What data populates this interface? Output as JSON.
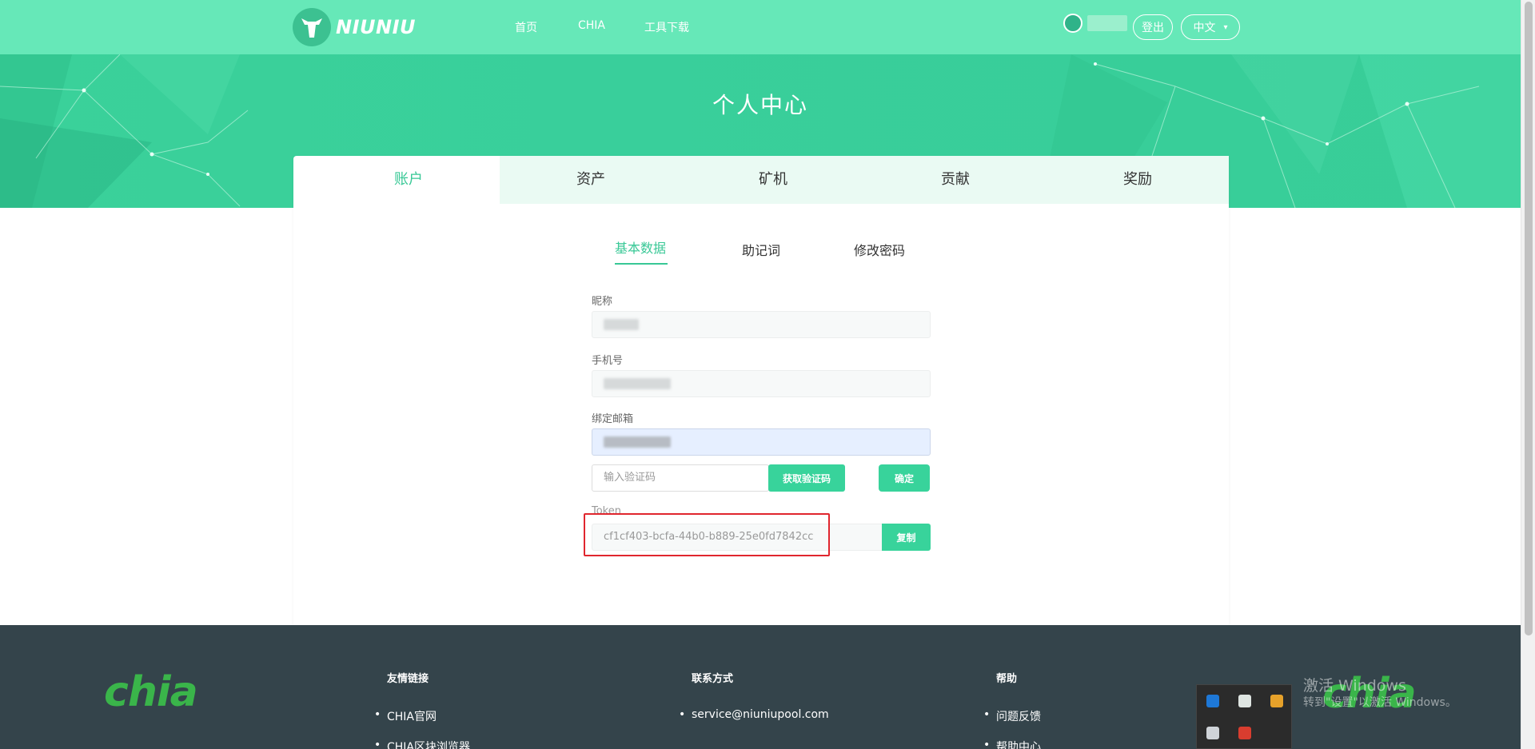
{
  "header": {
    "logo_text": "NIUNIU",
    "nav": [
      "首页",
      "CHIA",
      "工具下载"
    ],
    "logout_label": "登出",
    "language_label": "中文",
    "language_caret": "▾"
  },
  "hero": {
    "title": "个人中心"
  },
  "tabs": [
    "账户",
    "资产",
    "矿机",
    "贡献",
    "奖励"
  ],
  "subtabs": [
    "基本数据",
    "助记词",
    "修改密码"
  ],
  "form": {
    "nickname_label": "昵称",
    "phone_label": "手机号",
    "email_label": "绑定邮箱",
    "code_placeholder": "输入验证码",
    "get_code_label": "获取验证码",
    "confirm_label": "确定",
    "token_label": "Token",
    "token_value": "cf1cf403-bcfa-44b0-b889-25e0fd7842cc",
    "copy_label": "复制"
  },
  "footer": {
    "logo_text": "chia",
    "links_title": "友情链接",
    "links": [
      "CHIA官网",
      "CHIA区块浏览器"
    ],
    "contact_title": "联系方式",
    "contact": [
      "service@niuniupool.com"
    ],
    "help_title": "帮助",
    "help": [
      "问题反馈",
      "帮助中心"
    ]
  },
  "windows": {
    "activate_title": "激活 Windows",
    "activate_sub": "转到\"设置\"以激活 Windows。"
  },
  "colors": {
    "header_bg": "#66e8b8",
    "hero_bg": "#39cf9b",
    "accent": "#38c896",
    "button": "#38d39b",
    "footer_bg": "#34444b",
    "chia_green": "#3ab54a",
    "highlight_red": "#e0262e"
  }
}
